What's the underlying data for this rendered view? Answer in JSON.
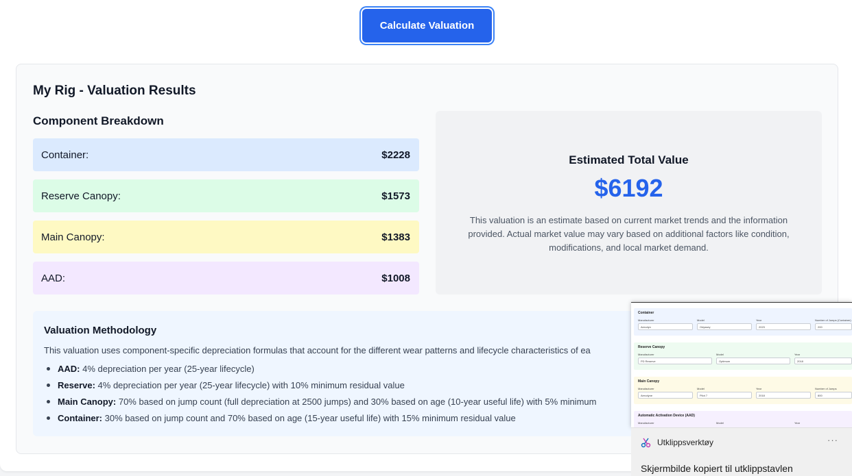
{
  "button": {
    "label": "Calculate Valuation"
  },
  "results": {
    "title": "My Rig - Valuation Results",
    "breakdown_title": "Component Breakdown",
    "components": [
      {
        "label": "Container:",
        "value": "$2228",
        "color": "#dbeafe"
      },
      {
        "label": "Reserve Canopy:",
        "value": "$1573",
        "color": "#dcfce7"
      },
      {
        "label": "Main Canopy:",
        "value": "$1383",
        "color": "#fef9c3"
      },
      {
        "label": "AAD:",
        "value": "$1008",
        "color": "#f3e8ff"
      }
    ],
    "total": {
      "label": "Estimated Total Value",
      "value": "$6192",
      "note": "This valuation is an estimate based on current market trends and the information provided. Actual market value may vary based on additional factors like condition, modifications, and local market demand."
    }
  },
  "methodology": {
    "title": "Valuation Methodology",
    "intro": "This valuation uses component-specific depreciation formulas that account for the different wear patterns and lifecycle characteristics of ea",
    "items": [
      {
        "name": "AAD:",
        "text": " 4% depreciation per year (25-year lifecycle)"
      },
      {
        "name": "Reserve:",
        "text": " 4% depreciation per year (25-year lifecycle) with 10% minimum residual value"
      },
      {
        "name": "Main Canopy:",
        "text": " 70% based on jump count (full depreciation at 2500 jumps) and 30% based on age (10-year useful life) with 5% minimum"
      },
      {
        "name": "Container:",
        "text": " 30% based on jump count and 70% based on age (15-year useful life) with 15% minimum residual value"
      }
    ]
  },
  "snip_preview": {
    "sections": [
      {
        "title": "Container",
        "color": "#eef4ff",
        "labels": [
          "Manufacturer",
          "Model",
          "Year",
          "Number of Jumps (Container)"
        ],
        "values": [
          "Aerodyn",
          "Odyssey",
          "2023",
          "200"
        ]
      },
      {
        "title": "Reserve Canopy",
        "color": "#eefbf1",
        "labels": [
          "Manufacturer",
          "Model",
          "Year"
        ],
        "values": [
          "PD Reserve",
          "Optimum",
          "2018"
        ]
      },
      {
        "title": "Main Canopy",
        "color": "#fefae6",
        "labels": [
          "Manufacturer",
          "Model",
          "Year",
          "Number of Jumps"
        ],
        "values": [
          "Aerodyne",
          "Pilot 7",
          "2018",
          "800"
        ]
      },
      {
        "title": "Automatic Activation Device (AAD)",
        "color": "#f6f0fe",
        "labels": [
          "Manufacturer",
          "Model",
          "Year"
        ],
        "values": [
          "",
          "",
          ""
        ]
      }
    ]
  },
  "toast": {
    "app_name": "Utklippsverktøy",
    "more": "···",
    "message": "Skjermbilde kopiert til utklippstavlen"
  }
}
